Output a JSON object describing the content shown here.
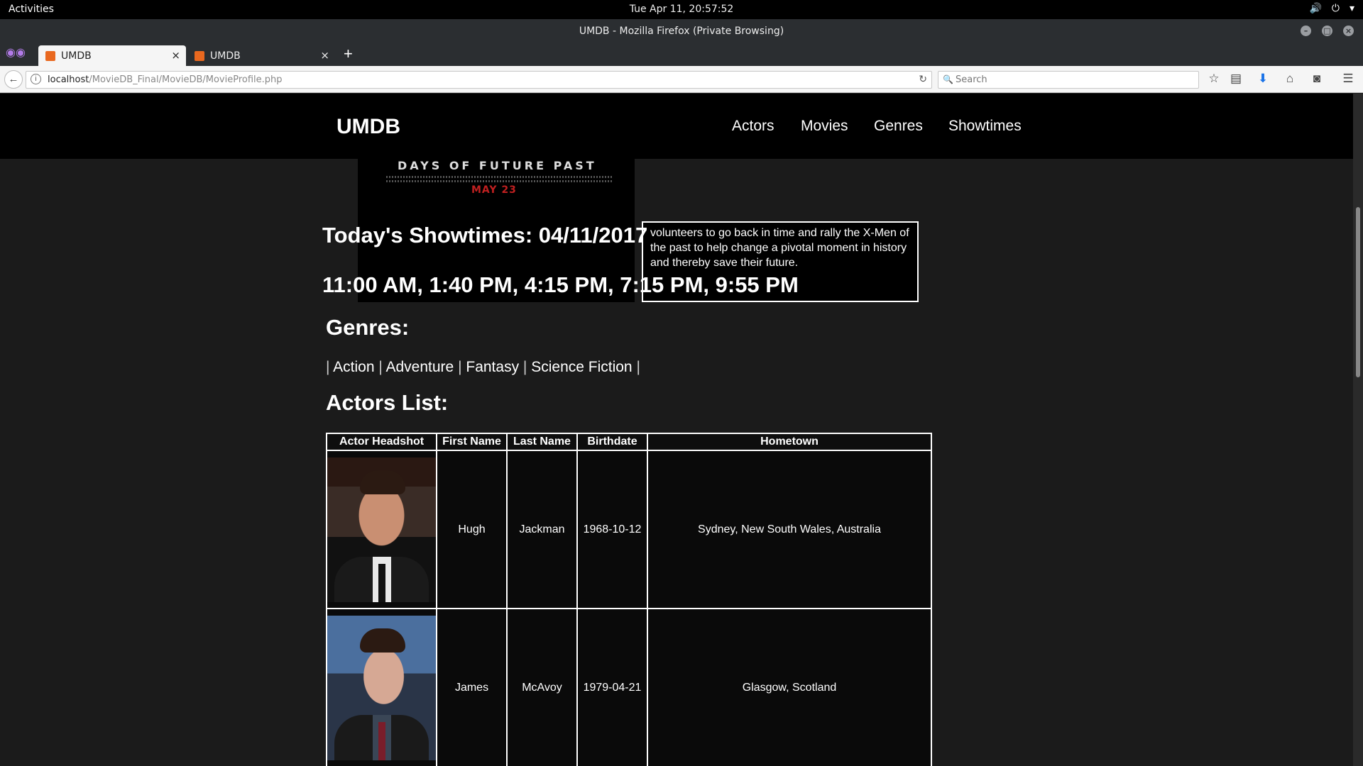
{
  "system": {
    "activities": "Activities",
    "clock": "Tue Apr 11, 20:57:52"
  },
  "window": {
    "title": "UMDB - Mozilla Firefox (Private Browsing)"
  },
  "tabs": [
    {
      "label": "UMDB",
      "active": true
    },
    {
      "label": "UMDB",
      "active": false
    }
  ],
  "navbar": {
    "url_host": "localhost",
    "url_path": "/MovieDB_Final/MovieDB/MovieProfile.php",
    "search_placeholder": "Search"
  },
  "site": {
    "brand": "UMDB",
    "nav": [
      "Actors",
      "Movies",
      "Genres",
      "Showtimes"
    ]
  },
  "movie": {
    "poster_title": "DAYS OF FUTURE PAST",
    "poster_date": "MAY 23",
    "synopsis_lines": [
      "volunteers to go back in time and rally the X-Men of",
      "the past to help change a pivotal moment in history",
      "and thereby save their future."
    ],
    "showtimes_heading": "Today's Showtimes: 04/11/2017",
    "showtimes": "11:00 AM, 1:40 PM, 4:15 PM, 7:15 PM, 9:55 PM",
    "genres_heading": "Genres:",
    "genres": [
      "Action",
      "Adventure",
      "Fantasy",
      "Science Fiction"
    ],
    "actors_heading": "Actors List:"
  },
  "actors_table": {
    "headers": [
      "Actor Headshot",
      "First Name",
      "Last Name",
      "Birthdate",
      "Hometown"
    ],
    "rows": [
      {
        "first": "Hugh",
        "last": "Jackman",
        "birthdate": "1968-10-12",
        "hometown": "Sydney, New South Wales, Australia"
      },
      {
        "first": "James",
        "last": "McAvoy",
        "birthdate": "1979-04-21",
        "hometown": "Glasgow, Scotland"
      }
    ]
  },
  "colors": {
    "page_bg": "#1b1b1b",
    "header_bg": "#000000",
    "accent_favicon": "#e9681f",
    "private_mask": "#b27be8"
  }
}
